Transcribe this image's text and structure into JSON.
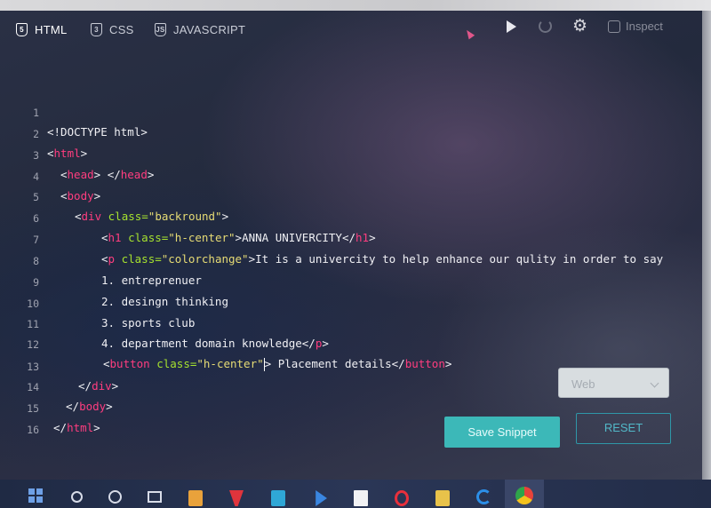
{
  "tabs": [
    {
      "label": "HTML",
      "icon": "html5-icon",
      "active": true
    },
    {
      "label": "CSS",
      "icon": "css3-icon",
      "active": false
    },
    {
      "label": "JAVASCRIPT",
      "icon": "js-icon",
      "active": false
    }
  ],
  "toolbar": {
    "run_icon": "play-icon",
    "reset_icon": "refresh-icon",
    "settings_icon": "gear-icon",
    "inspect_label": "Inspect"
  },
  "code_lines": [
    {
      "n": "1"
    },
    {
      "n": "2"
    },
    {
      "n": "3"
    },
    {
      "n": "4"
    },
    {
      "n": "5"
    },
    {
      "n": "6"
    },
    {
      "n": "7"
    },
    {
      "n": "8"
    },
    {
      "n": "9"
    },
    {
      "n": "10"
    },
    {
      "n": "11"
    },
    {
      "n": "12"
    },
    {
      "n": "13"
    },
    {
      "n": "14"
    },
    {
      "n": "15"
    },
    {
      "n": "16"
    }
  ],
  "code": {
    "l1": "<!DOCTYPE html>",
    "l2_tag": "html",
    "l3_open": "head",
    "l3_close": "head",
    "l4_tag": "body",
    "l5_tag": "div",
    "l5_attr": "class=",
    "l5_val": "\"backround\"",
    "l6_tag": "h1",
    "l6_attr": "class=",
    "l6_val": "\"h-center\"",
    "l6_text": "ANNA UNIVERCITY",
    "l6_close": "h1",
    "l7_tag": "p",
    "l7_attr": "class=",
    "l7_val": "\"colorchange\"",
    "l7_text": "It is a univercity to help enhance our qulity in order to say",
    "l8": "1. entreprenuer",
    "l9": "2. desingn thinking",
    "l10": "3. sports club",
    "l11_text": "4. department domain knowledge",
    "l11_close": "p",
    "l12_tag": "button",
    "l12_attr": "class=",
    "l12_val": "\"h-center\"",
    "l12_text": " Placement details",
    "l12_close": "button",
    "l13_close": "div",
    "l14_close": "body",
    "l15_close": "html"
  },
  "controls": {
    "select_value": "Web",
    "save_label": "Save Snippet",
    "reset_label": "RESET"
  },
  "taskbar": {
    "icons": [
      "windows-icon",
      "search-icon",
      "cortana-icon",
      "task-view-icon",
      "store-icon",
      "office-icon",
      "mail-icon",
      "media-player-icon",
      "file-icon",
      "opera-icon",
      "file-explorer-icon",
      "edge-icon",
      "chrome-icon"
    ]
  },
  "colors": {
    "tag": "#ff3d7f",
    "attr": "#a6e22e",
    "string": "#e6db74",
    "accent": "#3cb8b8"
  }
}
